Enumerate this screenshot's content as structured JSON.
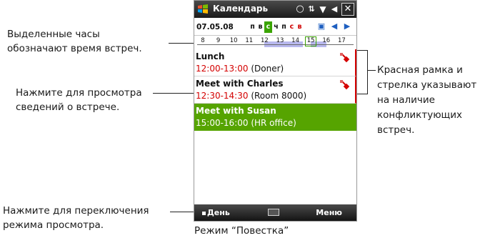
{
  "callouts": {
    "hours": [
      "Выделенные часы",
      "обозначают время встреч."
    ],
    "tap_details": [
      "Нажмите для просмотра",
      "сведений о встрече."
    ],
    "conflict": [
      "Красная рамка и",
      "стрелка указывают",
      "на наличие",
      "конфликтующих",
      "встреч."
    ],
    "switch_view": [
      "Нажмите для переключения",
      "режима просмотра."
    ]
  },
  "caption": "Режим “Повестка”",
  "phone": {
    "titlebar": {
      "title": "Календарь",
      "icons": [
        "speech-bubble-icon",
        "sync-icon",
        "signal-icon",
        "volume-icon",
        "close-icon"
      ]
    },
    "nav": {
      "date": "07.05.08",
      "weekdays": [
        "п",
        "в",
        "с",
        "ч",
        "п",
        "с",
        "в"
      ],
      "today_index": 2
    },
    "timeline": {
      "hours": [
        "8",
        "9",
        "10",
        "11",
        "12",
        "13",
        "14",
        "15",
        "16",
        "17"
      ],
      "busy_hours": [
        {
          "from": 12,
          "to": 14.5
        },
        {
          "from": 15,
          "to": 16
        }
      ],
      "current_hour": 15
    },
    "appointments": [
      {
        "name": "Lunch",
        "time": "12:00-13:00",
        "location": "(Doner)",
        "conflict": true,
        "selected": false
      },
      {
        "name": "Meet with Charles",
        "time": "12:30-14:30",
        "location": "(Room 8000)",
        "conflict": true,
        "selected": false
      },
      {
        "name": "Meet with Susan",
        "time": "15:00-16:00",
        "location": "(HR office)",
        "conflict": false,
        "selected": true
      }
    ],
    "softkeys": {
      "left": "День",
      "right": "Меню"
    }
  },
  "colors": {
    "today": "#3aa400",
    "selected_row": "#56a400",
    "conflict": "#d40000",
    "busy": "#b9b9ee"
  }
}
